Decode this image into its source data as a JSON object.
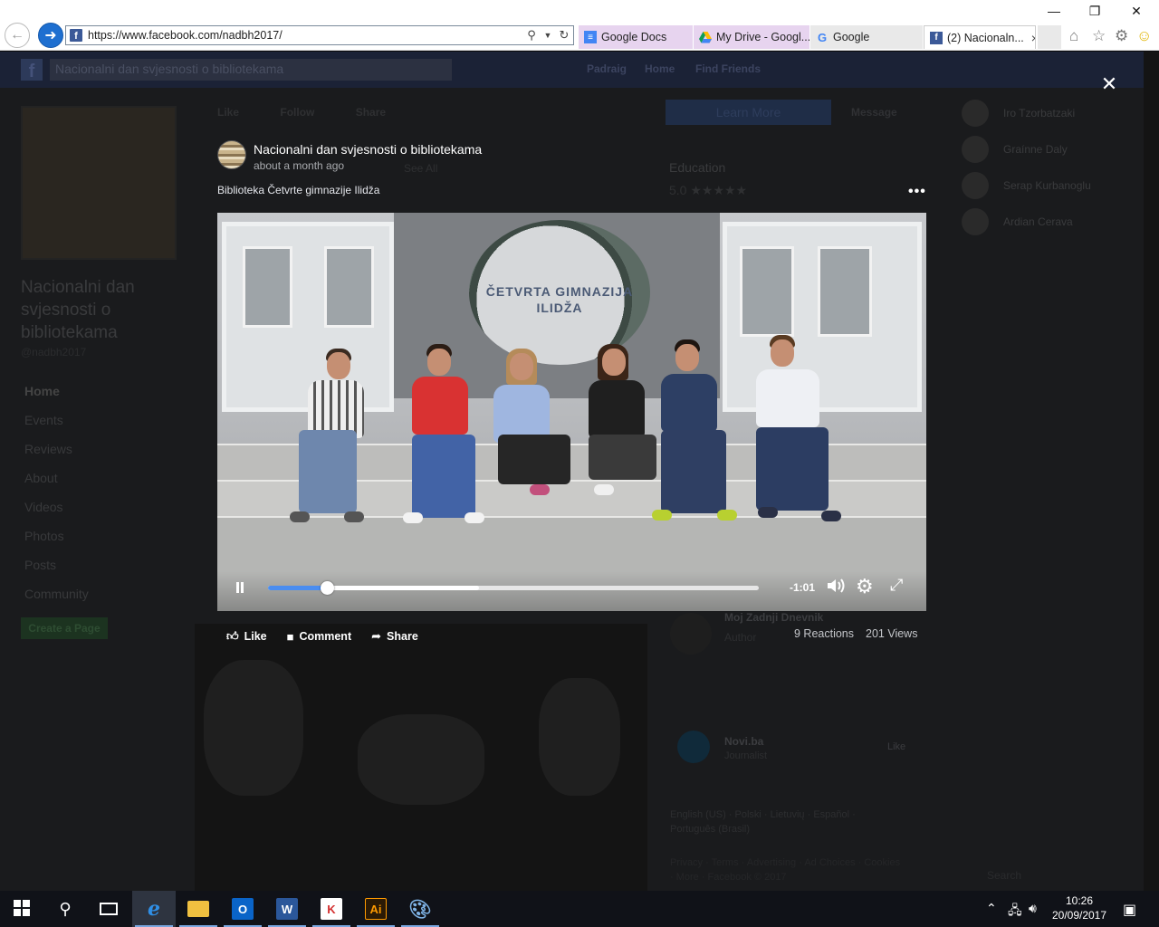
{
  "browser": {
    "url": "https://www.facebook.com/nadbh2017/",
    "tabs": [
      {
        "label": "Google Docs"
      },
      {
        "label": "My Drive - Googl..."
      },
      {
        "label": "Google"
      },
      {
        "label": "(2) Nacionaln..."
      }
    ],
    "close_tab_glyph": "×"
  },
  "facebook": {
    "search_value": "Nacionalni dan svjesnosti o bibliotekama",
    "nav": {
      "user": "Padraig",
      "home": "Home",
      "find_friends": "Find Friends"
    },
    "page_name": "Nacionalni dan svjesnosti o bibliotekama",
    "page_handle": "@nadbh2017",
    "side_nav": [
      "Home",
      "Events",
      "Reviews",
      "About",
      "Videos",
      "Photos",
      "Posts",
      "Community"
    ],
    "create_page": "Create a Page",
    "bg_actions": {
      "like": "Like",
      "follow": "Follow",
      "share": "Share",
      "learn_more": "Learn More",
      "message": "Message"
    },
    "bg_info": {
      "category": "Education",
      "rating": "5.0 ★★★★★",
      "see_all": "See All"
    },
    "contacts": [
      {
        "name": "Iro Tzorbatzaki"
      },
      {
        "name": "Graínne Daly"
      },
      {
        "name": "Serap Kurbanoglu"
      },
      {
        "name": "Ardian Cerava"
      }
    ],
    "bg_news": {
      "title": "Moj Zadnji Dnevnik",
      "sub": "Author",
      "source": "Novi.ba",
      "source_sub": "Journalist",
      "like": "Like",
      "langs": "English (US) · Polski · Lietuvių · Español · Português (Brasil)",
      "footer": "Privacy · Terms · Advertising · Ad Choices · Cookies · More · Facebook © 2017"
    },
    "chat_search": "Search"
  },
  "modal": {
    "post_title": "Nacionalni dan svjesnosti o bibliotekama",
    "post_time": "about a month ago",
    "post_text": "Biblioteka Četvrte gimnazije Ilidža",
    "more_glyph": "•••",
    "close_glyph": "✕",
    "video": {
      "sign_text": "ČETVRTA GIMNAZIJA ILIDŽA",
      "progress": 0.12,
      "buffered": 0.43,
      "time_remaining": "-1:01"
    },
    "actions": {
      "like": "Like",
      "comment": "Comment",
      "share": "Share"
    },
    "reactions": "9 Reactions",
    "views": "201 Views"
  },
  "taskbar": {
    "time": "10:26",
    "date": "20/09/2017"
  },
  "colors": {
    "fb_blue": "#3b5998",
    "progress_blue": "#4a8df0",
    "ie_blue": "#1e6fd0"
  }
}
